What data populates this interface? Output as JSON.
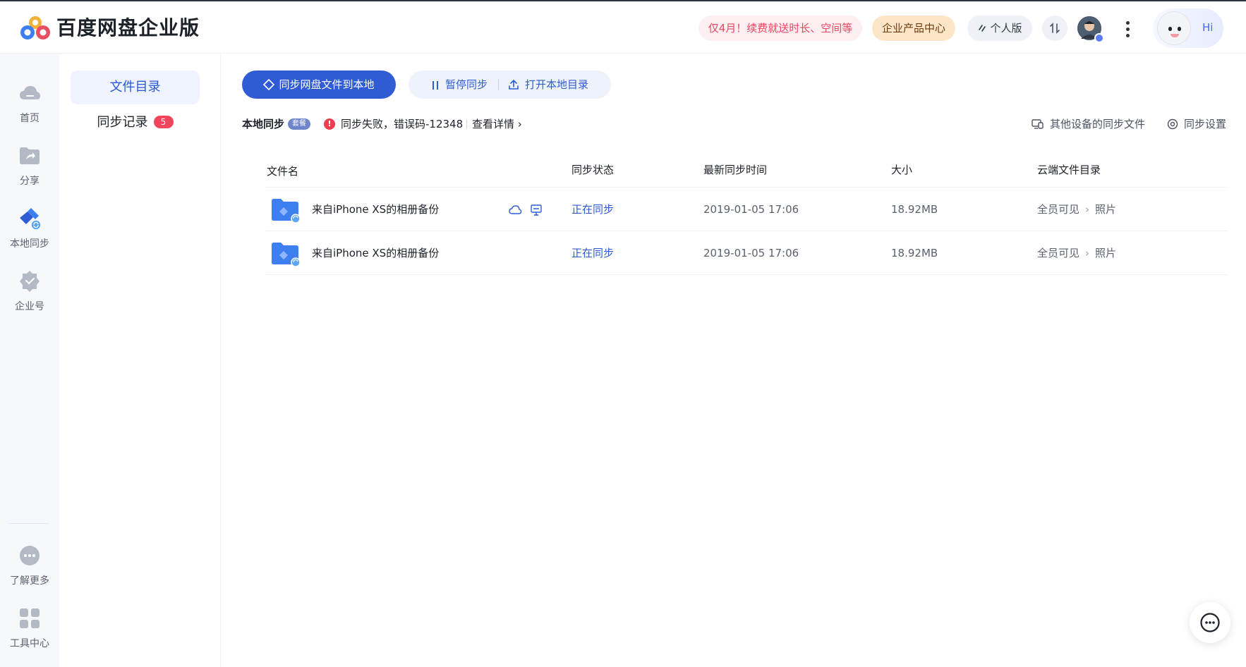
{
  "app": {
    "brand": "百度网盘企业版"
  },
  "header": {
    "promo_label": "仅4月！续费就送时长、空间等",
    "biz_center_label": "企业产品中心",
    "personal_label": "个人版",
    "mascot_greeting": "Hi"
  },
  "rail": {
    "items": [
      {
        "label": "首页",
        "icon": "cloud-icon"
      },
      {
        "label": "分享",
        "icon": "share-folder-icon"
      },
      {
        "label": "本地同步",
        "icon": "sync-icon"
      },
      {
        "label": "企业号",
        "icon": "verified-shield-icon"
      },
      {
        "label": "了解更多",
        "icon": "more-icon"
      },
      {
        "label": "工具中心",
        "icon": "apps-grid-icon"
      }
    ]
  },
  "subnav": {
    "items": [
      {
        "label": "文件目录",
        "active": true
      },
      {
        "label": "同步记录",
        "badge": "5"
      }
    ]
  },
  "toolbar": {
    "sync_to_local_label": "同步网盘文件到本地",
    "pause_label": "暂停同步",
    "open_local_label": "打开本地目录"
  },
  "status": {
    "title": "本地同步",
    "tag": "套餐",
    "error_text": "同步失败，错误码-12348",
    "detail_link": "查看详情"
  },
  "links": {
    "other_devices": "其他设备的同步文件",
    "sync_settings": "同步设置"
  },
  "table": {
    "headers": {
      "name": "文件名",
      "status": "同步状态",
      "time": "最新同步时间",
      "size": "大小",
      "cloud_dir": "云端文件目录"
    },
    "rows": [
      {
        "name": "来自iPhone XS的相册备份",
        "status": "正在同步",
        "time": "2019-01-05 17:06",
        "size": "18.92MB",
        "dir_root": "全员可见",
        "dir_leaf": "照片",
        "show_icons": true
      },
      {
        "name": "来自iPhone XS的相册备份",
        "status": "正在同步",
        "time": "2019-01-05 17:06",
        "size": "18.92MB",
        "dir_root": "全员可见",
        "dir_leaf": "照片",
        "show_icons": false
      }
    ]
  },
  "colors": {
    "accent": "#2f5bd5",
    "error": "#ec3f52",
    "badge": "#f0455a"
  }
}
